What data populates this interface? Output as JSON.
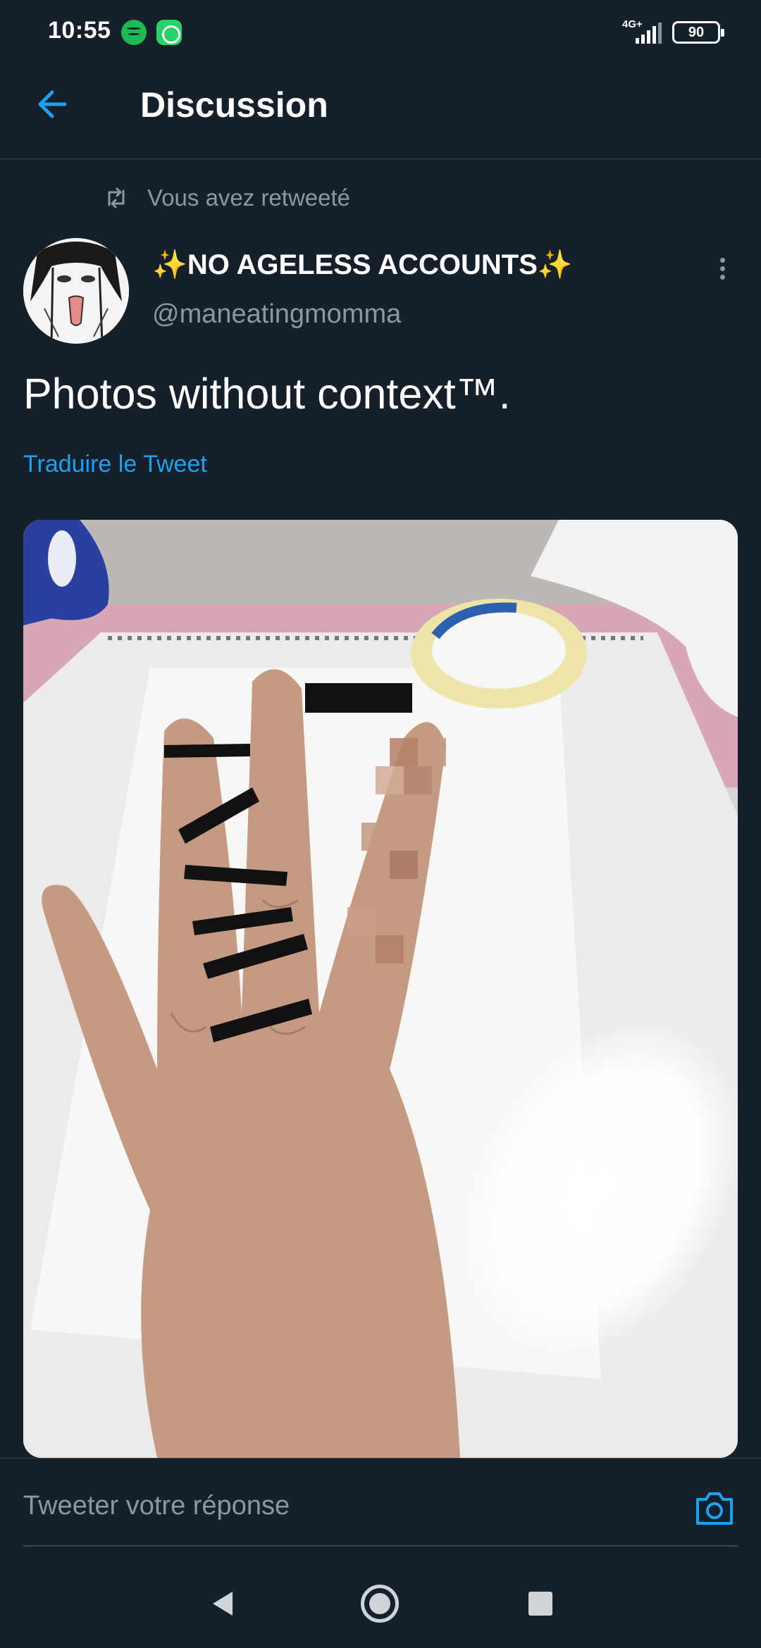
{
  "status_bar": {
    "time": "10:55",
    "network": "4G+",
    "battery": "90",
    "notification_icons": [
      "spotify-icon",
      "whatsapp-icon"
    ]
  },
  "header": {
    "title": "Discussion",
    "back_icon": "arrow-left-icon"
  },
  "tweet": {
    "retweet_label": "Vous avez retweeté",
    "display_name": "NO AGELESS ACCOUNTS",
    "name_decoration": "✨",
    "handle": "@maneatingmomma",
    "text": "Photos without context™.",
    "translate_link": "Traduire le Tweet",
    "media_description_icon": "photo-hand-icon"
  },
  "reply": {
    "placeholder": "Tweeter votre réponse",
    "camera_icon": "camera-icon"
  },
  "nav": {
    "back_icon": "nav-back-icon",
    "home_icon": "nav-home-icon",
    "recents_icon": "nav-recents-icon"
  },
  "colors": {
    "background": "#15202b",
    "divider": "#38444d",
    "secondary_text": "#8899a6",
    "accent": "#1da1f2"
  }
}
